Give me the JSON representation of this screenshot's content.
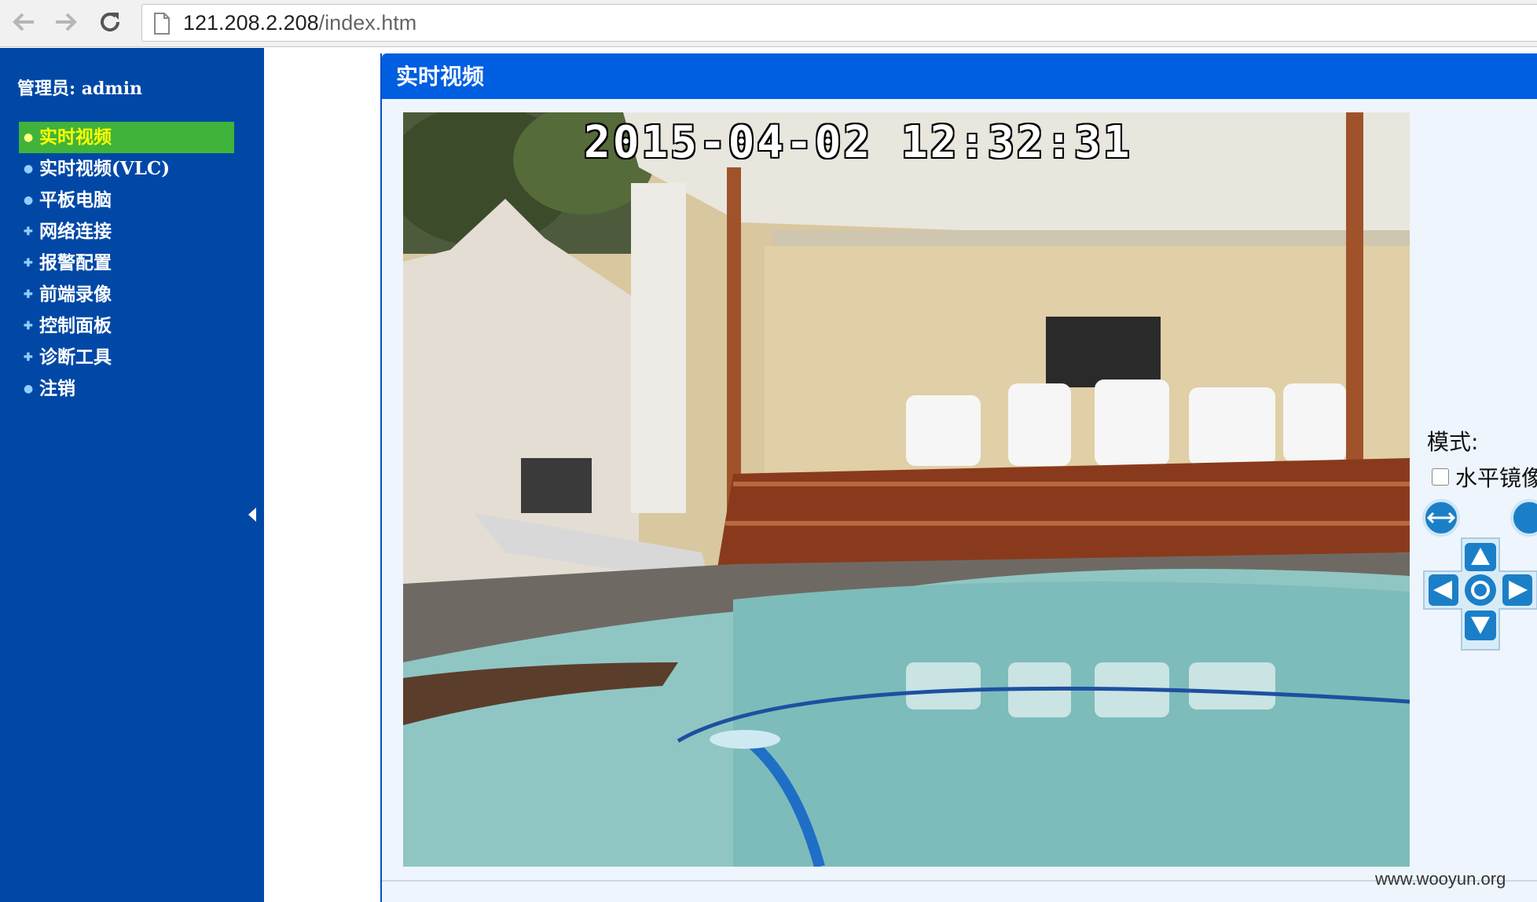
{
  "browser": {
    "url_host": "121.208.2.208",
    "url_path": "/index.htm",
    "icons": [
      "back-arrow-icon",
      "forward-arrow-icon",
      "reload-icon",
      "page-icon"
    ]
  },
  "sidebar": {
    "admin_label": "管理员: admin",
    "items": [
      {
        "label": "实时视频",
        "active": true,
        "bullet": "dot"
      },
      {
        "label": "实时视频(VLC)",
        "active": false,
        "bullet": "dot"
      },
      {
        "label": "平板电脑",
        "active": false,
        "bullet": "dot"
      },
      {
        "label": "网络连接",
        "active": false,
        "bullet": "plus"
      },
      {
        "label": "报警配置",
        "active": false,
        "bullet": "plus"
      },
      {
        "label": "前端录像",
        "active": false,
        "bullet": "plus"
      },
      {
        "label": "控制面板",
        "active": false,
        "bullet": "plus"
      },
      {
        "label": "诊断工具",
        "active": false,
        "bullet": "plus"
      },
      {
        "label": "注销",
        "active": false,
        "bullet": "dot"
      }
    ],
    "colors": {
      "background": "#0148a6",
      "active_bg": "#40b33b",
      "active_text": "#ffff00"
    }
  },
  "main": {
    "panel_title": "实时视频",
    "video_timestamp": "2015-04-02 12:32:31",
    "mode_label": "模式:",
    "mirror_label": "水平镜像",
    "mirror_checked": false,
    "ptz_icons": [
      "horizontal-swap-icon",
      "up-arrow-icon",
      "left-arrow-icon",
      "center-icon",
      "right-arrow-icon",
      "down-arrow-icon"
    ],
    "colors": {
      "header": "#005ee0",
      "panel_bg": "#eef5fd"
    }
  },
  "watermark": "www.wooyun.org"
}
